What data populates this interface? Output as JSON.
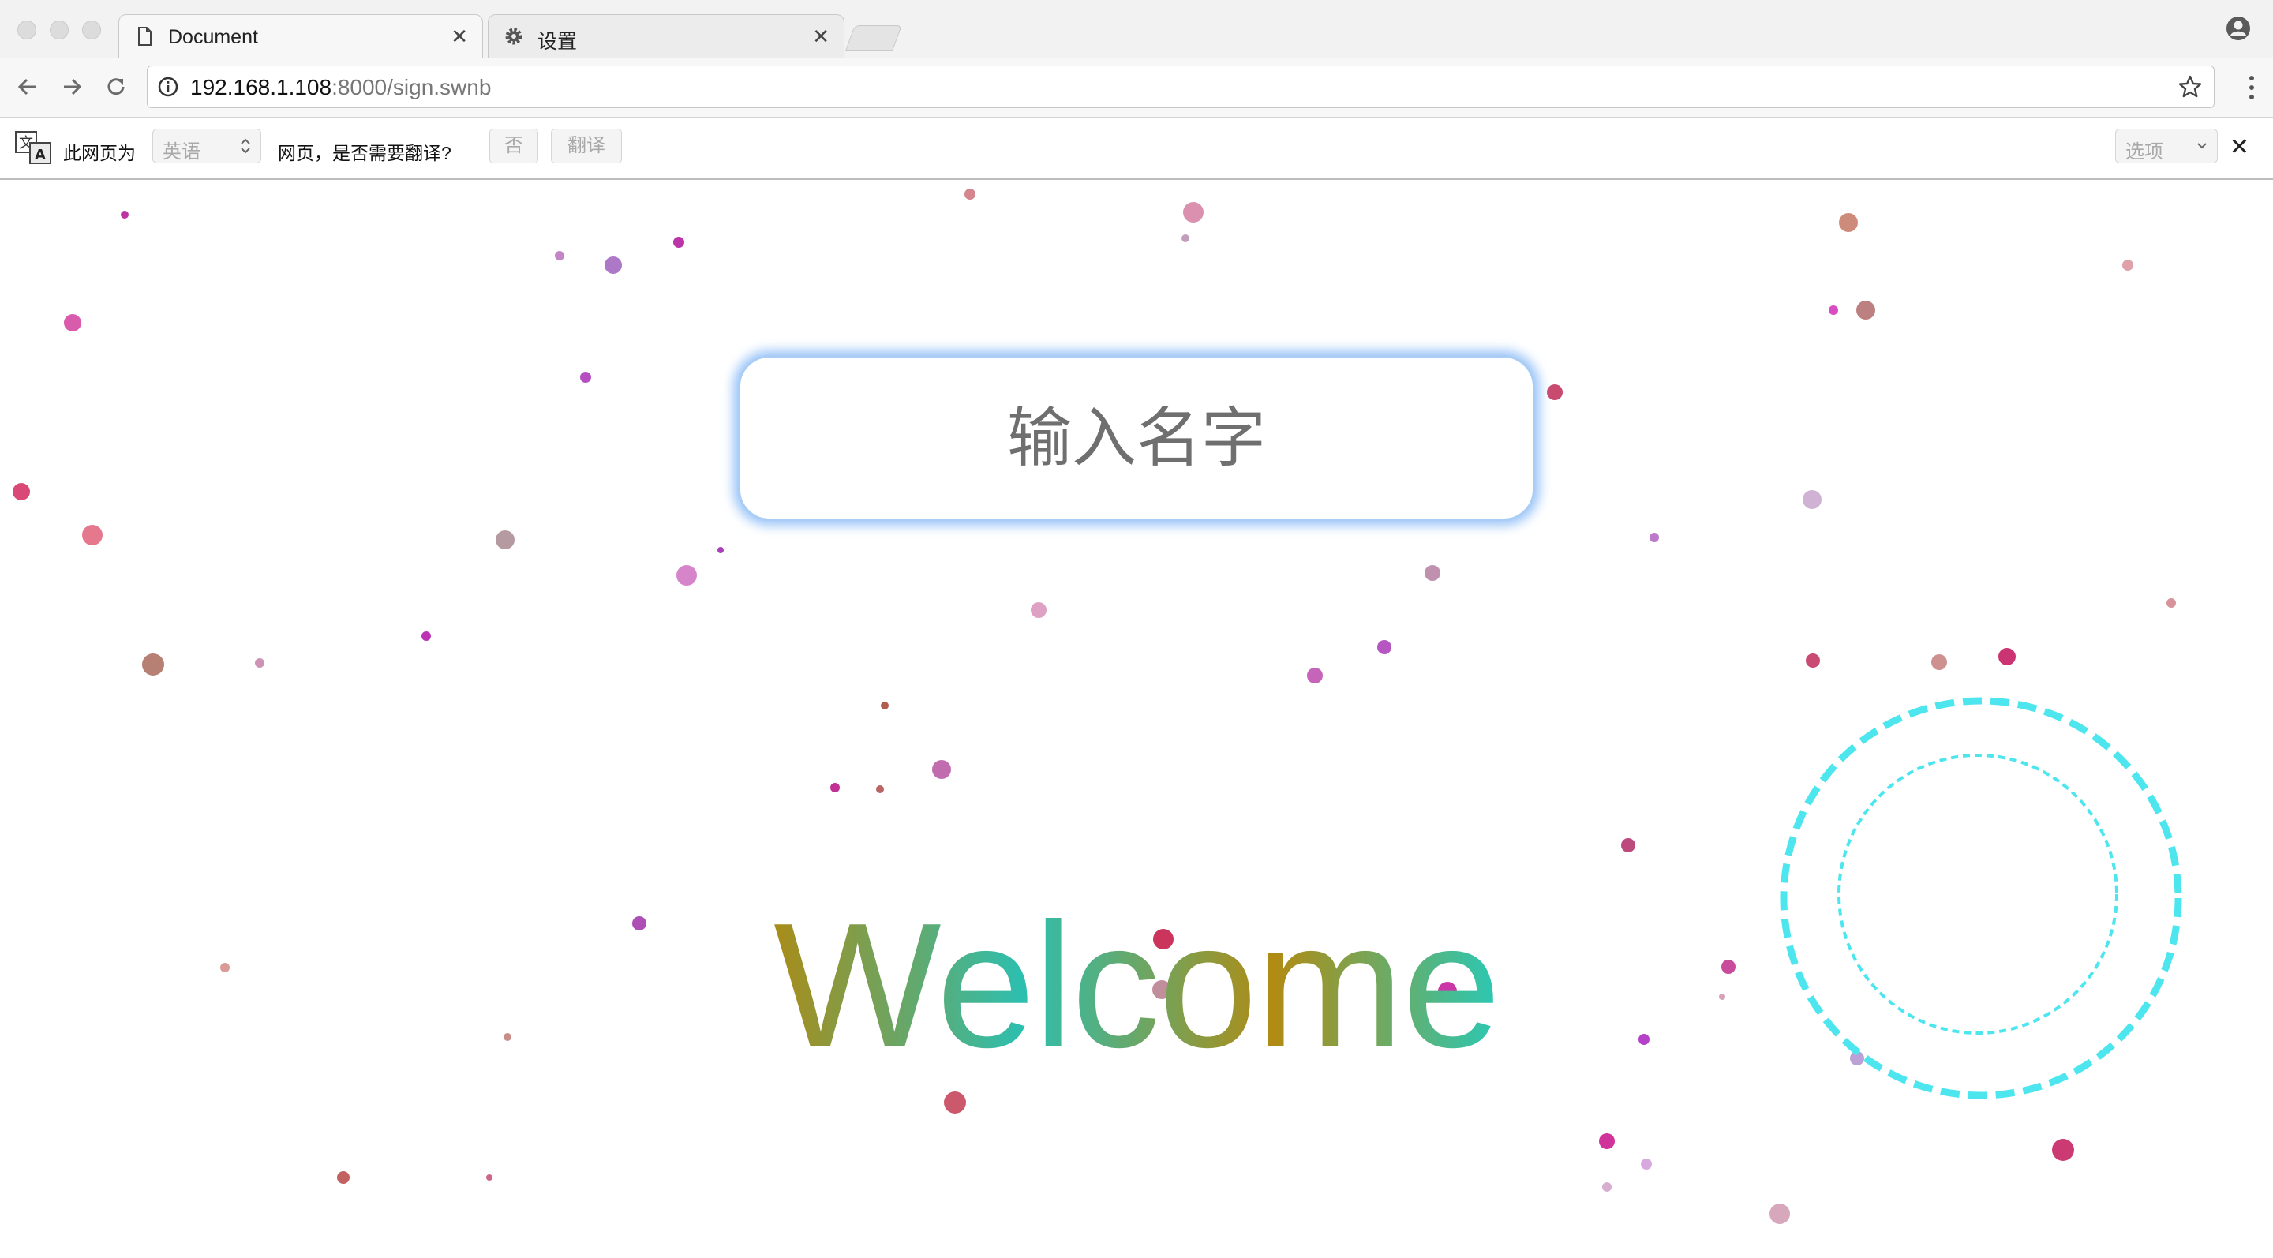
{
  "browser": {
    "tabs": [
      {
        "title": "Document",
        "icon": "page-icon",
        "active": true
      },
      {
        "title": "设置",
        "icon": "gear-icon",
        "active": false
      }
    ],
    "url_host": "192.168.1.108",
    "url_rest": ":8000/sign.swnb"
  },
  "translate_bar": {
    "prefix": "此网页为",
    "language": "英语",
    "question": "网页，是否需要翻译?",
    "no_label": "否",
    "translate_label": "翻译",
    "options_label": "选项"
  },
  "page": {
    "name_placeholder": "输入名字",
    "welcome_text": "Welcome",
    "accent_ring_color": "#4ee6ee"
  }
}
